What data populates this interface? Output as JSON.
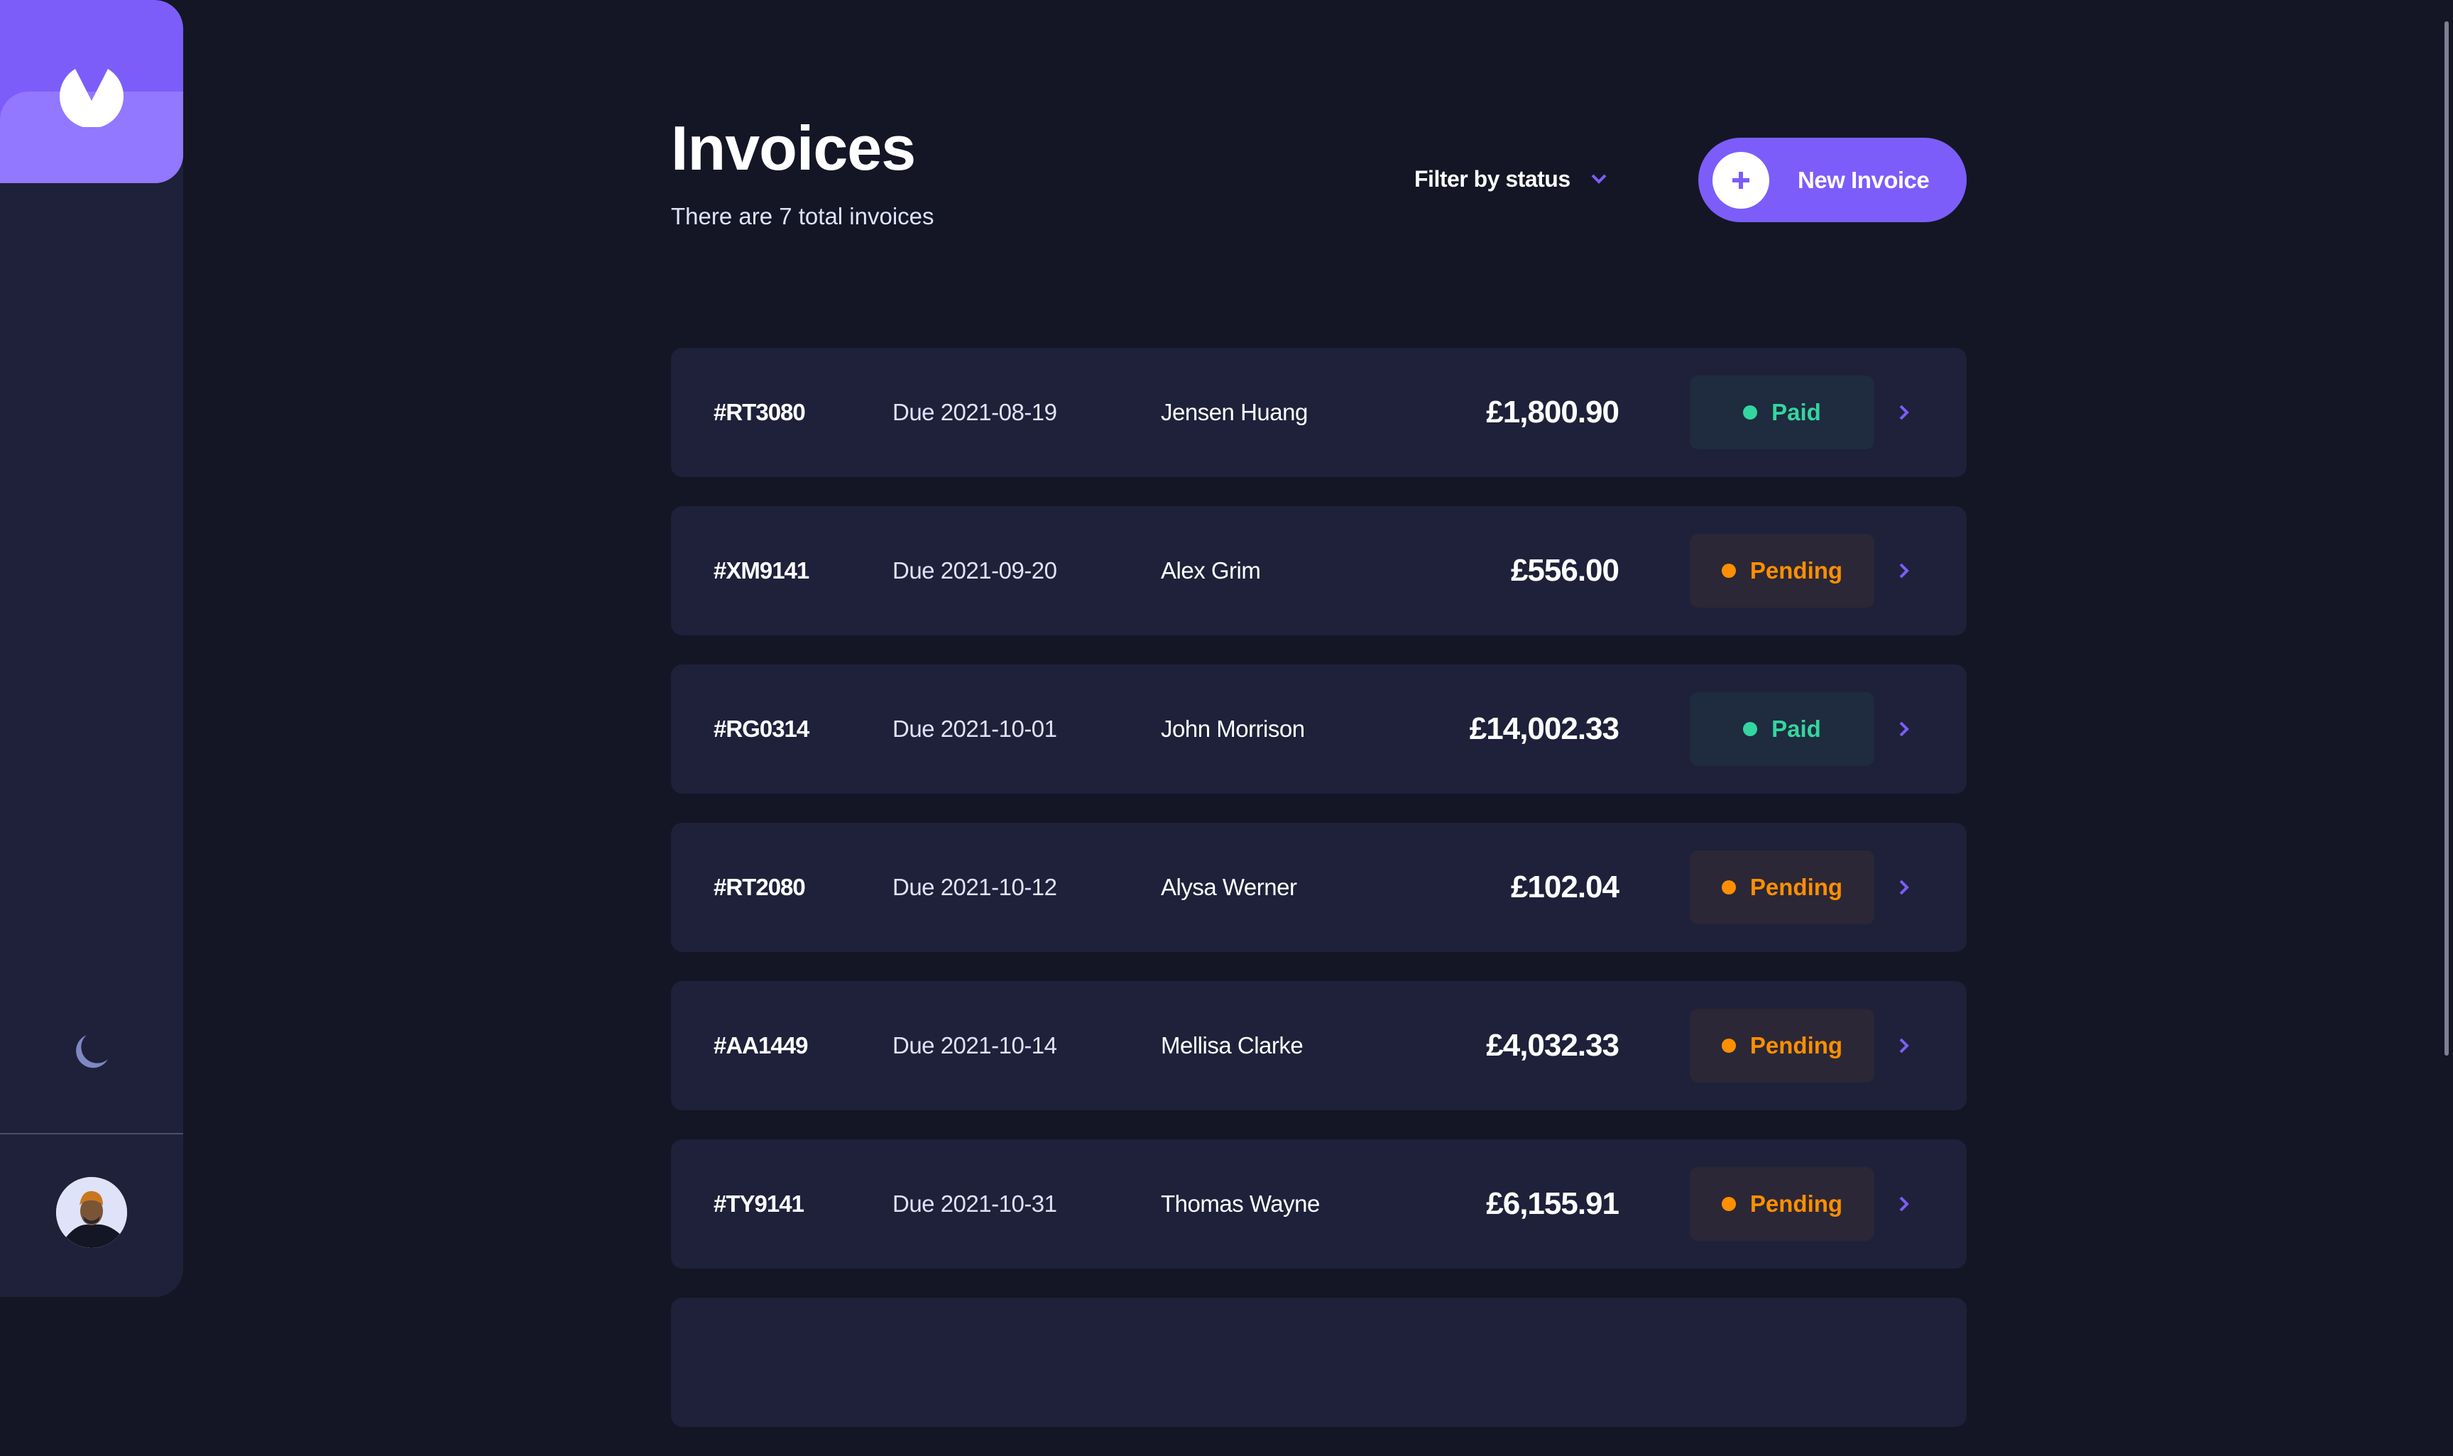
{
  "sidebar": {
    "logo_icon": "logo-icon",
    "theme_toggle_icon": "moon-icon",
    "avatar_icon": "avatar-image"
  },
  "header": {
    "title": "Invoices",
    "subtitle": "There are 7 total invoices",
    "filter_label": "Filter by status",
    "filter_icon": "chevron-down-icon",
    "new_invoice_label": "New Invoice",
    "new_invoice_icon": "plus-icon"
  },
  "colors": {
    "accent": "#7C5DFA",
    "accent_light": "#9277FF",
    "background": "#141625",
    "card": "#1E2139",
    "paid": "#33D69F",
    "pending": "#FF8F00"
  },
  "invoices": [
    {
      "id": "#RT3080",
      "due": "Due 2021-08-19",
      "client": "Jensen Huang",
      "amount": "£1,800.90",
      "status": "Paid"
    },
    {
      "id": "#XM9141",
      "due": "Due 2021-09-20",
      "client": "Alex Grim",
      "amount": "£556.00",
      "status": "Pending"
    },
    {
      "id": "#RG0314",
      "due": "Due 2021-10-01",
      "client": "John Morrison",
      "amount": "£14,002.33",
      "status": "Paid"
    },
    {
      "id": "#RT2080",
      "due": "Due 2021-10-12",
      "client": "Alysa Werner",
      "amount": "£102.04",
      "status": "Pending"
    },
    {
      "id": "#AA1449",
      "due": "Due 2021-10-14",
      "client": "Mellisa Clarke",
      "amount": "£4,032.33",
      "status": "Pending"
    },
    {
      "id": "#TY9141",
      "due": "Due 2021-10-31",
      "client": "Thomas Wayne",
      "amount": "£6,155.91",
      "status": "Pending"
    }
  ]
}
